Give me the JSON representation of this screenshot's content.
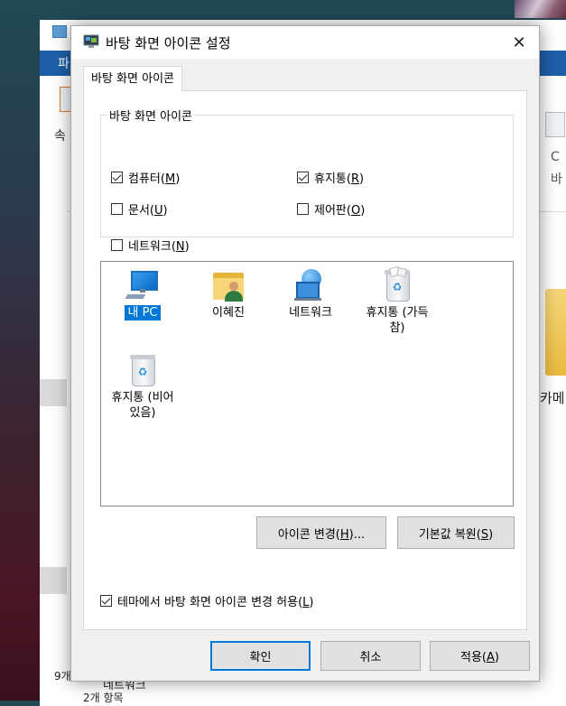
{
  "dialog": {
    "title": "바탕 화면 아이콘 설정",
    "close_glyph": "✕",
    "tab_label": "바탕 화면 아이콘",
    "group_title": "바탕 화면 아이콘",
    "checkboxes": [
      {
        "label": "컴퓨터",
        "mnemonic": "M",
        "checked": true
      },
      {
        "label": "휴지통",
        "mnemonic": "R",
        "checked": true
      },
      {
        "label": "문서",
        "mnemonic": "U",
        "checked": false
      },
      {
        "label": "제어판",
        "mnemonic": "O",
        "checked": false
      },
      {
        "label": "네트워크",
        "mnemonic": "N",
        "checked": false
      }
    ],
    "icons": [
      {
        "label": "내 PC",
        "selected": true,
        "icon": "computer-icon"
      },
      {
        "label": "이혜진",
        "selected": false,
        "icon": "user-folder-icon"
      },
      {
        "label": "네트워크",
        "selected": false,
        "icon": "network-icon"
      },
      {
        "label": "휴지통 (가득 참)",
        "label_line1": "휴지통 (가득",
        "label_line2": "참)",
        "selected": false,
        "icon": "recycle-bin-full-icon"
      },
      {
        "label": "휴지통 (비어 있음)",
        "label_line1": "휴지통 (비어",
        "label_line2": "있음)",
        "selected": false,
        "icon": "recycle-bin-empty-icon"
      }
    ],
    "change_icon_button": {
      "label": "아이콘 변경",
      "mnemonic": "H",
      "suffix": "..."
    },
    "restore_default_button": {
      "label": "기본값 복원",
      "mnemonic": "S"
    },
    "allow_theme_checkbox": {
      "label": "테마에서 바탕 화면 아이콘 변경 허용",
      "mnemonic": "L",
      "checked": true
    },
    "ok_button": "확인",
    "cancel_button": "취소",
    "apply_button": {
      "label": "적용",
      "mnemonic": "A"
    }
  },
  "background": {
    "ribbon_tab_fragment": "파",
    "left_fragment": "속",
    "right_fragment_1": "C",
    "right_fragment_2": "바",
    "folder_fragment": "카메",
    "count_fragment": "9개",
    "nav_item_fragment": "네트워크",
    "status_fragment": "2개 항목"
  },
  "colors": {
    "accent": "#0078d7",
    "ribbon": "#1e5faa"
  }
}
